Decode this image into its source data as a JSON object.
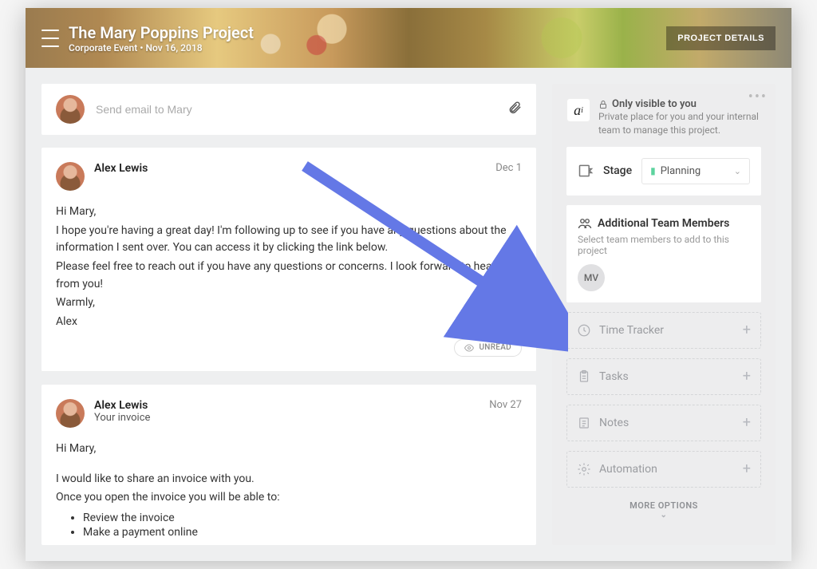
{
  "header": {
    "title": "The Mary Poppins Project",
    "subtitle": "Corporate Event • Nov 16, 2018",
    "details_button": "PROJECT DETAILS"
  },
  "compose": {
    "placeholder": "Send email to Mary"
  },
  "messages": [
    {
      "author": "Alex Lewis",
      "date": "Dec 1",
      "body_lines": [
        "Hi Mary,",
        "I hope you're having a great day! I'm following up to see if you have any questions about the information I sent over. You can access it by clicking the link below.",
        "Please feel free to reach out if you have any questions or concerns. I look forward to hearing from you!",
        "Warmly,",
        "Alex"
      ],
      "unread": "UNREAD"
    },
    {
      "author": "Alex Lewis",
      "subject": "Your invoice",
      "date": "Nov 27",
      "body_lines": [
        "Hi Mary,",
        "",
        "I would like to share an invoice with you.",
        "Once you open the invoice you will be able to:"
      ],
      "bullets": [
        "Review the invoice",
        "Make a payment online"
      ]
    }
  ],
  "sidebar": {
    "visibility": {
      "title": "Only visible to you",
      "desc": "Private place for you and your internal team to manage this project."
    },
    "stage": {
      "label": "Stage",
      "value": "Planning"
    },
    "team": {
      "title": "Additional Team Members",
      "desc": "Select team members to add to this project",
      "members": [
        {
          "initials": "MV"
        }
      ]
    },
    "tools": {
      "time_tracker": "Time Tracker",
      "tasks": "Tasks",
      "notes": "Notes",
      "automation": "Automation"
    },
    "more_options": "MORE OPTIONS"
  }
}
